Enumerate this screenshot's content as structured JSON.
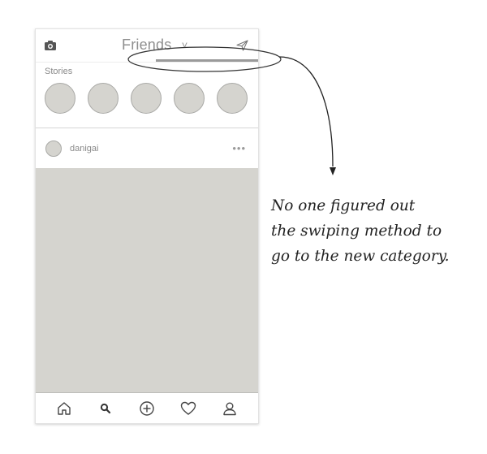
{
  "header": {
    "title": "Friends",
    "camera_icon": "camera-icon",
    "dropdown_icon": "chevron-down-icon",
    "send_icon": "send-icon"
  },
  "stories": {
    "label": "Stories",
    "count": 5
  },
  "post": {
    "username": "danigai",
    "more_icon": "more-icon"
  },
  "bottom_nav": {
    "items": [
      "home-icon",
      "search-icon",
      "add-icon",
      "heart-icon",
      "profile-icon"
    ]
  },
  "annotation": {
    "lines": [
      "No one figured out",
      "the swiping method to",
      "go to the  new category."
    ]
  },
  "colors": {
    "placeholder_fill": "#d5d4cf",
    "text_gray": "#8a8a8a",
    "ink": "#222222"
  }
}
